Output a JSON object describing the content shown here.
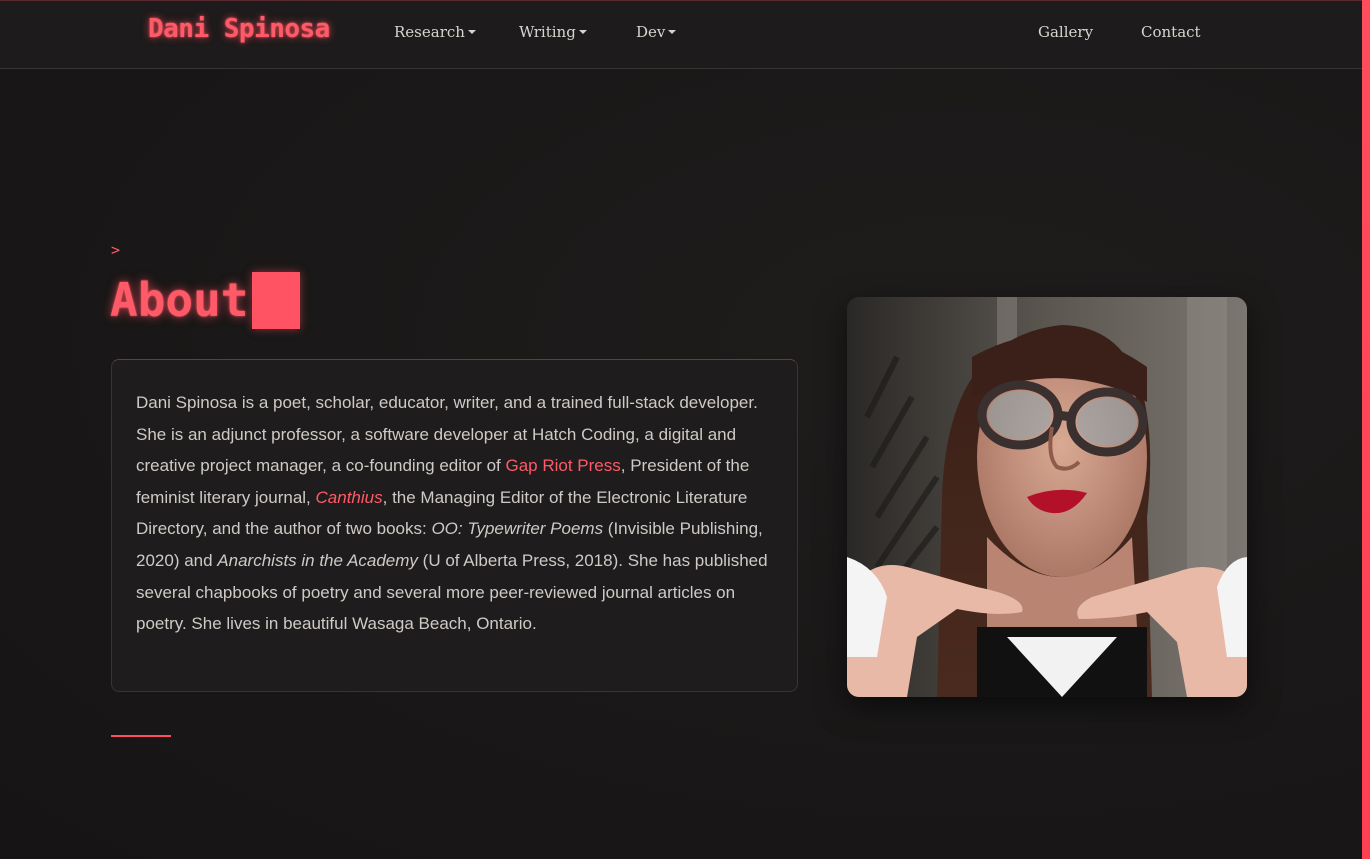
{
  "nav": {
    "brand": "Dani Spinosa",
    "items": [
      {
        "label": "Research",
        "dropdown": true
      },
      {
        "label": "Writing",
        "dropdown": true
      },
      {
        "label": "Dev",
        "dropdown": true
      }
    ],
    "right_items": [
      {
        "label": "Gallery"
      },
      {
        "label": "Contact"
      }
    ]
  },
  "section": {
    "prompt": ">",
    "title": "About"
  },
  "about": {
    "p1": "Dani Spinosa is a poet, scholar, educator, writer, and a trained full-stack developer. She is an adjunct professor, a software developer at Hatch Coding, a digital and creative project manager, a co-founding editor of ",
    "link_gap_riot": "Gap Riot Press",
    "p2": ", President of the feminist literary journal, ",
    "link_canthius": "Canthius",
    "p3": ", the Managing Editor of the Electronic Literature Directory, and the author of two books: ",
    "book1": "OO: Typewriter Poems",
    "p4": " (Invisible Publishing, 2020) and ",
    "book2": "Anarchists in the Academy",
    "p5": " (U of Alberta Press, 2018). She has published several chapbooks of poetry and several more peer-reviewed journal articles on poetry. She lives in beautiful Wasaga Beach, Ontario."
  },
  "colors": {
    "accent": "#ff5a68",
    "background": "#1a1818",
    "text": "#cfcac6"
  },
  "icons": {
    "dropdown": "caret-down-icon",
    "portrait": "portrait-photo"
  }
}
